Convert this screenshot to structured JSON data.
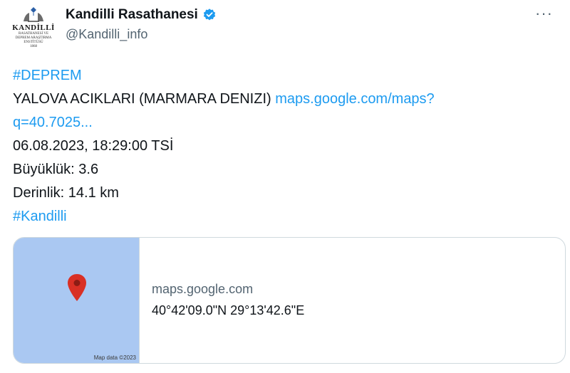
{
  "account": {
    "logo_line1": "KANDİLLİ",
    "logo_line2": "RASATHANESİ VE DEPREM ARAŞTIRMA ENSTİTÜSÜ",
    "logo_line3": "1868",
    "display_name": "Kandilli Rasathanesi",
    "handle": "@Kandilli_info",
    "verified": true,
    "more_label": "···"
  },
  "tweet": {
    "hashtag1": "#DEPREM",
    "location_text": "YALOVA ACIKLARI (MARMARA DENIZI) ",
    "link_part1": "maps.google.com/maps?",
    "link_part2": "q=40.7025...",
    "datetime": "06.08.2023, 18:29:00 TSİ",
    "magnitude": "Büyüklük: 3.6",
    "depth": "Derinlik: 14.1 km",
    "hashtag2": "#Kandilli"
  },
  "card": {
    "map_credit": "Map data ©2023",
    "domain": "maps.google.com",
    "title": "40°42'09.0\"N 29°13'42.6\"E"
  },
  "colors": {
    "link": "#1d9bf0",
    "map_water": "#aac8f2",
    "pin": "#d93025",
    "verified": "#1d9bf0"
  }
}
